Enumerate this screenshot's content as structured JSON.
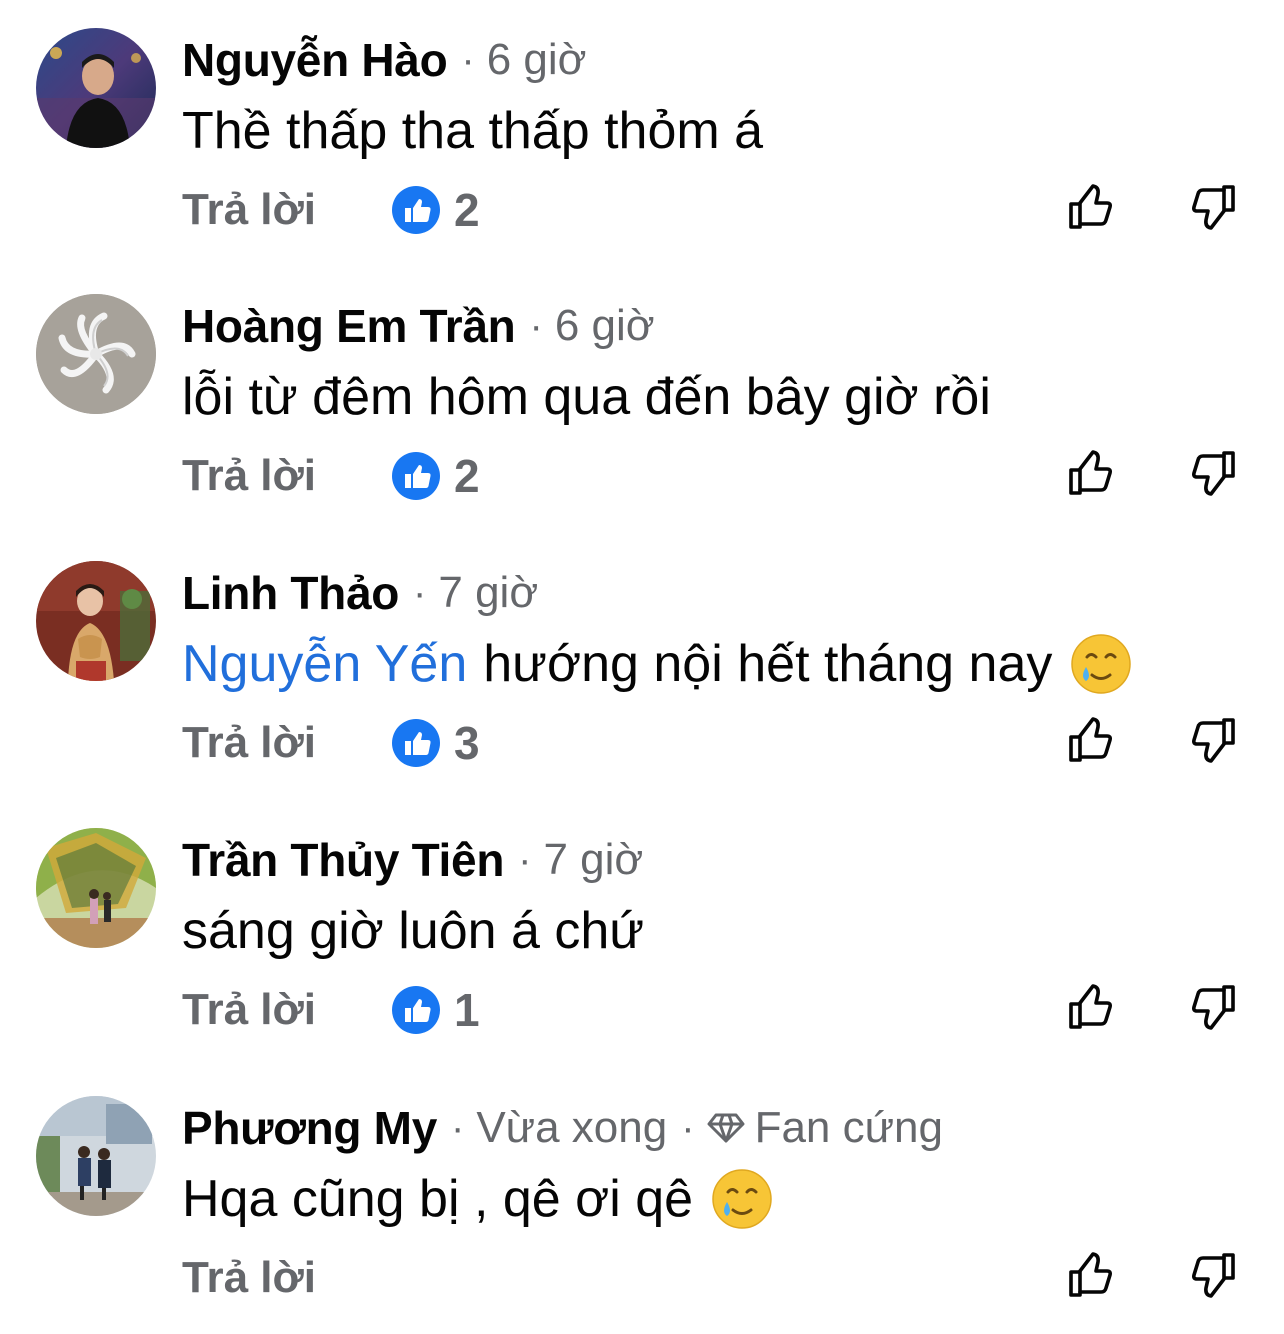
{
  "comments": [
    {
      "author": "Nguyễn Hào",
      "separator": "·",
      "time": "6 giờ",
      "text": "Thề thấp tha thấp thỏm á",
      "reply_label": "Trả lời",
      "like_count": "2"
    },
    {
      "author": "Hoàng Em Trần",
      "separator": "·",
      "time": "6 giờ",
      "text": "lỗi từ đêm hôm qua đến bây giờ rồi",
      "reply_label": "Trả lời",
      "like_count": "2"
    },
    {
      "author": "Linh Thảo",
      "separator": "·",
      "time": "7 giờ",
      "mention": "Nguyễn Yến",
      "text": "hướng nội hết tháng nay",
      "emoji": "smiling-face-with-tear",
      "reply_label": "Trả lời",
      "like_count": "3"
    },
    {
      "author": "Trần Thủy Tiên",
      "separator": "·",
      "time": "7 giờ",
      "text": "sáng giờ luôn á chứ",
      "reply_label": "Trả lời",
      "like_count": "1"
    },
    {
      "author": "Phương My",
      "separator": "·",
      "time": "Vừa xong",
      "separator2": "·",
      "badge_icon": "diamond-icon",
      "badge": "Fan cứng",
      "text": "Hqa cũng bị , qê ơi qê",
      "emoji": "smiling-face-with-tear",
      "reply_label": "Trả lời"
    }
  ],
  "colors": {
    "accent_blue": "#216fdb",
    "like_badge": "#1877f2",
    "meta_gray": "#65676b",
    "text": "#050505"
  }
}
